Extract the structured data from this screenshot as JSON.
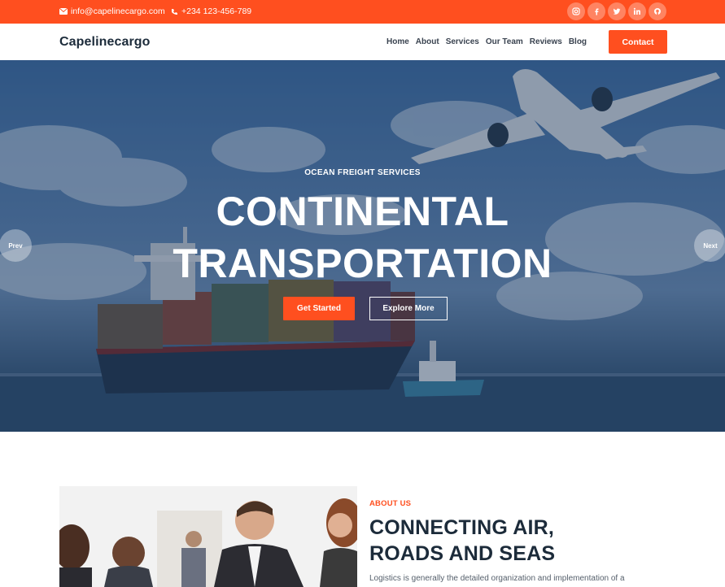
{
  "topbar": {
    "email": "info@capelinecargo.com",
    "phone": "+234 123-456-789",
    "socials": [
      "instagram-icon",
      "facebook-icon",
      "twitter-icon",
      "linkedin-icon",
      "github-icon"
    ]
  },
  "navbar": {
    "brand": "Capelinecargo",
    "links": [
      "Home",
      "About",
      "Services",
      "Our Team",
      "Reviews",
      "Blog"
    ],
    "contact_label": "Contact"
  },
  "hero": {
    "eyebrow": "OCEAN FREIGHT SERVICES",
    "title_line1": "CONTINENTAL",
    "title_line2": "TRANSPORTATION",
    "primary_label": "Get Started",
    "secondary_label": "Explore More",
    "prev_label": "Prev",
    "next_label": "Next"
  },
  "about": {
    "label": "ABOUT US",
    "title_line1": "CONNECTING AIR,",
    "title_line2": "ROADS AND SEAS",
    "text": "Logistics is generally the detailed organization and implementation of a"
  },
  "colors": {
    "accent": "#ff4f1f",
    "heading": "#1c2b3a"
  }
}
